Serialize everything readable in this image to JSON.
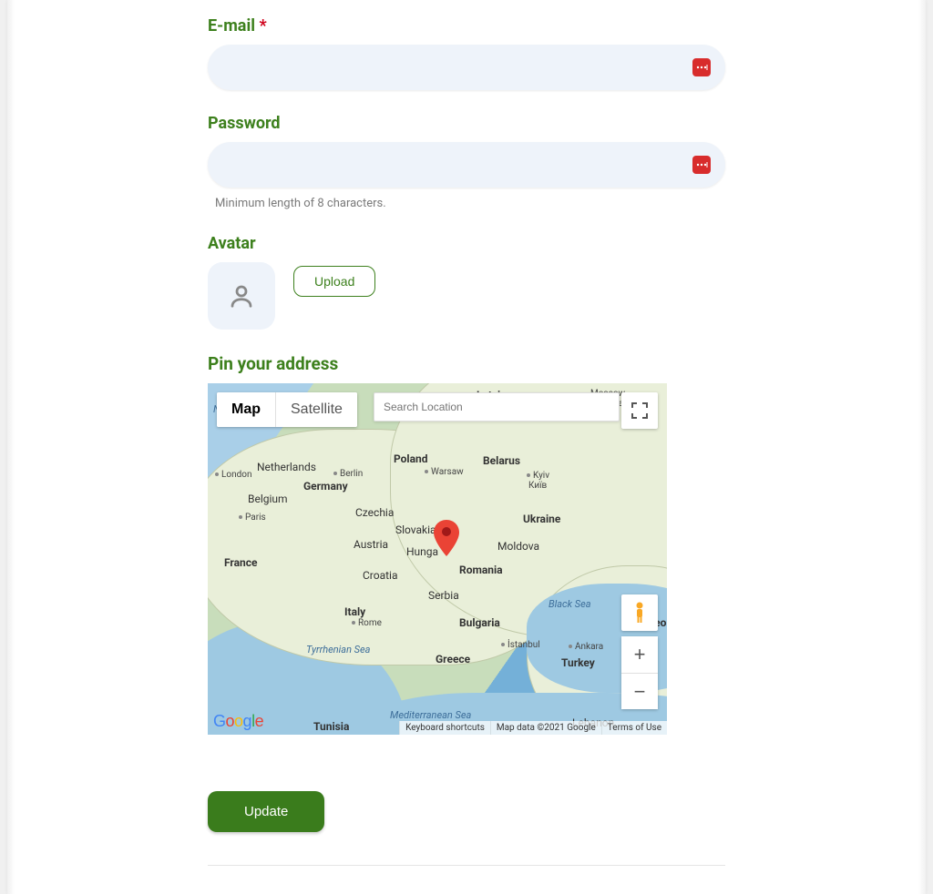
{
  "form": {
    "email": {
      "label": "E-mail",
      "required_mark": "*",
      "value": ""
    },
    "password": {
      "label": "Password",
      "value": "",
      "hint": "Minimum length of 8 characters."
    },
    "avatar": {
      "label": "Avatar",
      "upload_label": "Upload"
    },
    "address": {
      "label": "Pin your address"
    },
    "submit_label": "Update"
  },
  "map": {
    "tabs": {
      "map": "Map",
      "satellite": "Satellite"
    },
    "search_placeholder": "Search Location",
    "footer": {
      "shortcuts": "Keyboard shortcuts",
      "data": "Map data ©2021 Google",
      "terms": "Terms of Use"
    },
    "labels": {
      "latvia": "Latvia",
      "moscow": "Moscow",
      "moskva": "Москва",
      "north_sea": "North Sea",
      "netherlands": "Netherlands",
      "london": "London",
      "germany": "Germany",
      "berlin": "Berlin",
      "poland": "Poland",
      "warsaw": "Warsaw",
      "belarus": "Belarus",
      "kyiv": "Kyiv",
      "kyiv_uk": "Київ",
      "belgium": "Belgium",
      "paris": "Paris",
      "czechia": "Czechia",
      "ukraine": "Ukraine",
      "slovakia": "Slovakia",
      "austria": "Austria",
      "hungary": "Hunga",
      "moldova": "Moldova",
      "france": "France",
      "croatia": "Croatia",
      "romania": "Romania",
      "serbia": "Serbia",
      "italy": "Italy",
      "rome": "Rome",
      "bulgaria": "Bulgaria",
      "black_sea": "Black Sea",
      "georgia": "Geor",
      "ankara": "Ankara",
      "istanbul": "İstanbul",
      "turkey": "Turkey",
      "greece": "Greece",
      "tyrrhenian": "Tyrrhenian Sea",
      "mediterranean": "Mediterranean Sea",
      "tunisia": "Tunisia",
      "lebanon": "Lebanon"
    }
  }
}
